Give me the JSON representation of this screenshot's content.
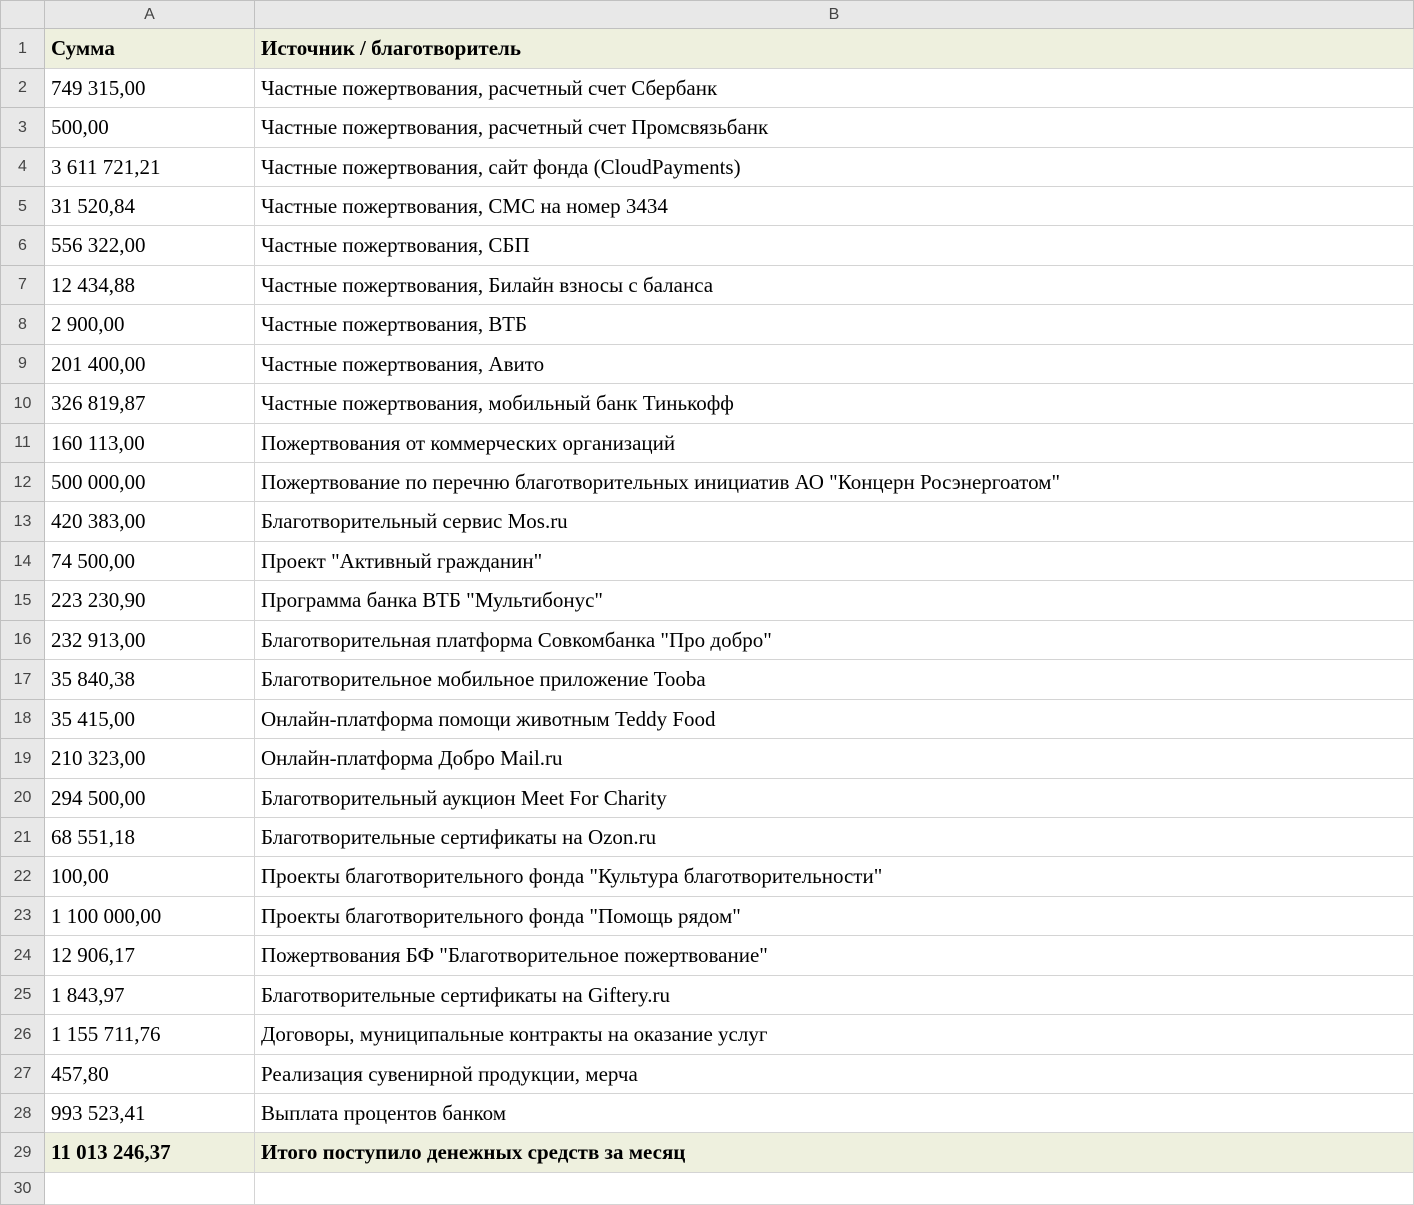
{
  "columns": {
    "a": "A",
    "b": "B"
  },
  "header": {
    "row_num": "1",
    "amount_label": "Сумма",
    "source_label": "Источник / благотворитель"
  },
  "rows": [
    {
      "num": "2",
      "amount": "749 315,00",
      "source": "Частные пожертвования, расчетный счет Сбербанк"
    },
    {
      "num": "3",
      "amount": "500,00",
      "source": "Частные пожертвования, расчетный счет Промсвязьбанк"
    },
    {
      "num": "4",
      "amount": "3 611 721,21",
      "source": "Частные пожертвования, сайт фонда (CloudPayments)"
    },
    {
      "num": "5",
      "amount": "31 520,84",
      "source": "Частные пожертвования, СМС на номер 3434"
    },
    {
      "num": "6",
      "amount": "556 322,00",
      "source": "Частные пожертвования, СБП"
    },
    {
      "num": "7",
      "amount": "12 434,88",
      "source": "Частные пожертвования, Билайн взносы с баланса"
    },
    {
      "num": "8",
      "amount": "2 900,00",
      "source": "Частные пожертвования, ВТБ"
    },
    {
      "num": "9",
      "amount": "201 400,00",
      "source": "Частные пожертвования, Авито"
    },
    {
      "num": "10",
      "amount": "326 819,87",
      "source": "Частные пожертвования, мобильный банк Тинькофф"
    },
    {
      "num": "11",
      "amount": "160 113,00",
      "source": "Пожертвования от коммерческих организаций"
    },
    {
      "num": "12",
      "amount": "500 000,00",
      "source": "Пожертвование по перечню благотворительных инициатив АО \"Концерн Росэнергоатом\""
    },
    {
      "num": "13",
      "amount": "420 383,00",
      "source": "Благотворительный сервис Mos.ru"
    },
    {
      "num": "14",
      "amount": "74 500,00",
      "source": "Проект \"Активный гражданин\""
    },
    {
      "num": "15",
      "amount": "223 230,90",
      "source": "Программа банка ВТБ \"Мультибонус\""
    },
    {
      "num": "16",
      "amount": "232 913,00",
      "source": "Благотворительная платформа Совкомбанка \"Про добро\""
    },
    {
      "num": "17",
      "amount": "35 840,38",
      "source": "Благотворительное мобильное приложение Tooba"
    },
    {
      "num": "18",
      "amount": "35 415,00",
      "source": "Онлайн-платформа помощи животным Teddy Food"
    },
    {
      "num": "19",
      "amount": "210 323,00",
      "source": "Онлайн-платформа Добро Mail.ru"
    },
    {
      "num": "20",
      "amount": "294 500,00",
      "source": "Благотворительный аукцион Meet For Charity"
    },
    {
      "num": "21",
      "amount": "68 551,18",
      "source": "Благотворительные сертификаты на Ozon.ru"
    },
    {
      "num": "22",
      "amount": "100,00",
      "source": "Проекты благотворительного фонда \"Культура благотворительности\""
    },
    {
      "num": "23",
      "amount": "1 100 000,00",
      "source": "Проекты благотворительного фонда \"Помощь рядом\""
    },
    {
      "num": "24",
      "amount": "12 906,17",
      "source": "Пожертвования БФ \"Благотворительное пожертвование\""
    },
    {
      "num": "25",
      "amount": "1 843,97",
      "source": "Благотворительные сертификаты на Giftery.ru"
    },
    {
      "num": "26",
      "amount": "1 155 711,76",
      "source": "Договоры, муниципальные контракты на оказание услуг"
    },
    {
      "num": "27",
      "amount": "457,80",
      "source": "Реализация сувенирной продукции, мерча"
    },
    {
      "num": "28",
      "amount": "993 523,41",
      "source": "Выплата процентов банком"
    }
  ],
  "total": {
    "num": "29",
    "amount": "11 013 246,37",
    "label": "Итого поступило денежных средств за месяц"
  },
  "trailing_row_num": "30"
}
